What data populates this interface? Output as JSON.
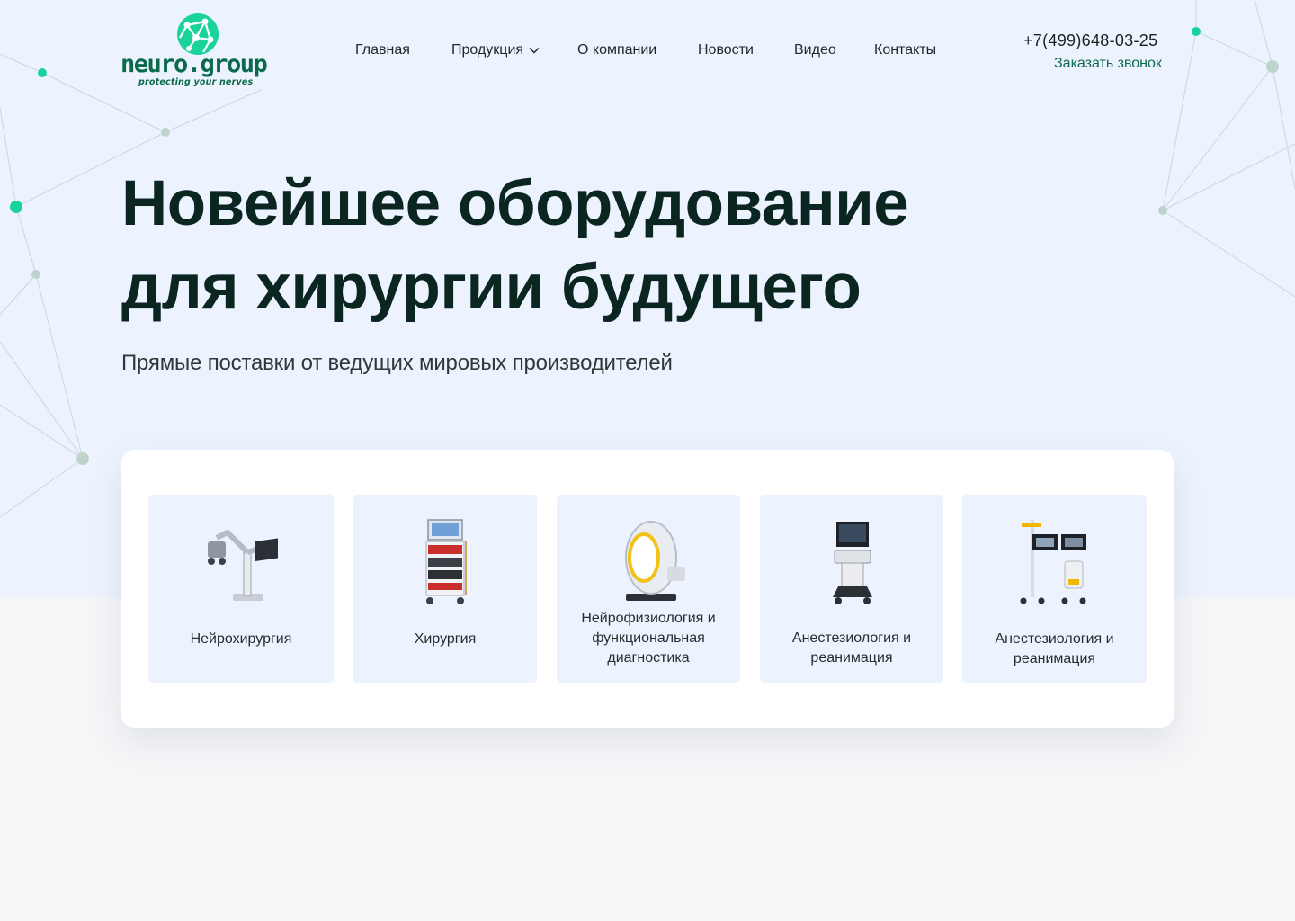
{
  "logo": {
    "wordmark": "neuro.group",
    "tagline": "protecting your nerves"
  },
  "nav": {
    "items": [
      {
        "label": "Главная",
        "name": "nav-item-home"
      },
      {
        "label": "Продукция",
        "name": "nav-item-products",
        "has_dropdown": true
      },
      {
        "label": "О компании",
        "name": "nav-item-about"
      },
      {
        "label": "Новости",
        "name": "nav-item-news"
      },
      {
        "label": "Видео",
        "name": "nav-item-video"
      },
      {
        "label": "Контакты",
        "name": "nav-item-contacts"
      }
    ]
  },
  "contact": {
    "phone": "+7(499)648-03-25",
    "callback": "Заказать звонок"
  },
  "hero": {
    "title_line1": "Новейшее оборудование",
    "title_line2": "для хирургии будущего",
    "subtitle": "Прямые поставки от ведущих мировых производителей"
  },
  "categories": [
    {
      "label": "Нейрохирургия",
      "icon": "surgical-microscope-icon"
    },
    {
      "label": "Хирургия",
      "icon": "endoscopy-tower-icon"
    },
    {
      "label": "Нейрофизиология и функциональная диагностика",
      "icon": "ring-scanner-icon"
    },
    {
      "label": "Анестезиология и реанимация",
      "icon": "ultrasound-cart-icon"
    },
    {
      "label": "Анестезиология и реанимация",
      "icon": "monitoring-stand-icon"
    }
  ],
  "colors": {
    "brand_green": "#0b6a4c",
    "accent_teal": "#1ad39a",
    "hero_bg": "#edf3fe",
    "page_bg": "#f5f6f8",
    "heading": "#0b2620"
  }
}
